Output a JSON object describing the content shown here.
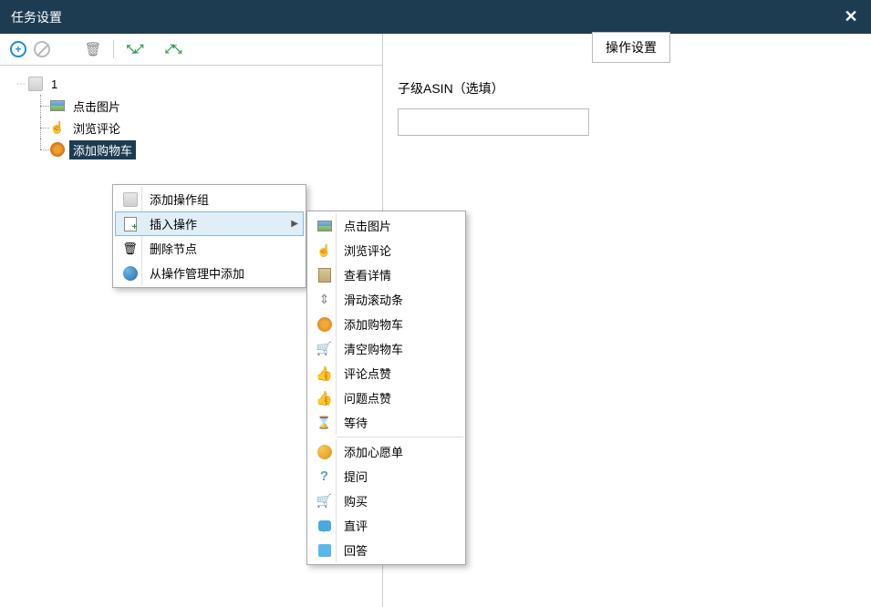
{
  "title": "任务设置",
  "tree": {
    "root": "1",
    "items": [
      {
        "label": "点击图片"
      },
      {
        "label": "浏览评论"
      },
      {
        "label": "添加购物车",
        "selected": true
      }
    ]
  },
  "contextMenu1": {
    "items": [
      {
        "label": "添加操作组",
        "icon": "cursor"
      },
      {
        "label": "插入操作",
        "icon": "doc-plus",
        "submenu": true,
        "hover": true
      },
      {
        "label": "删除节点",
        "icon": "trash"
      },
      {
        "label": "从操作管理中添加",
        "icon": "globe"
      }
    ]
  },
  "contextMenu2": {
    "group1": [
      {
        "label": "点击图片",
        "icon": "img"
      },
      {
        "label": "浏览评论",
        "icon": "hand"
      },
      {
        "label": "查看详情",
        "icon": "detail"
      },
      {
        "label": "滑动滚动条",
        "icon": "scroll"
      },
      {
        "label": "添加购物车",
        "icon": "cart-add"
      },
      {
        "label": "清空购物车",
        "icon": "cart-empty"
      },
      {
        "label": "评论点赞",
        "icon": "thumb"
      },
      {
        "label": "问题点赞",
        "icon": "thumb"
      },
      {
        "label": "等待",
        "icon": "hourglass"
      }
    ],
    "group2": [
      {
        "label": "添加心愿单",
        "icon": "wish"
      },
      {
        "label": "提问",
        "icon": "question"
      },
      {
        "label": "购买",
        "icon": "buy"
      },
      {
        "label": "直评",
        "icon": "chat"
      },
      {
        "label": "回答",
        "icon": "answer"
      }
    ]
  },
  "rightPanel": {
    "tab": "操作设置",
    "fieldLabel": "子级ASIN（选填）",
    "fieldValue": ""
  }
}
